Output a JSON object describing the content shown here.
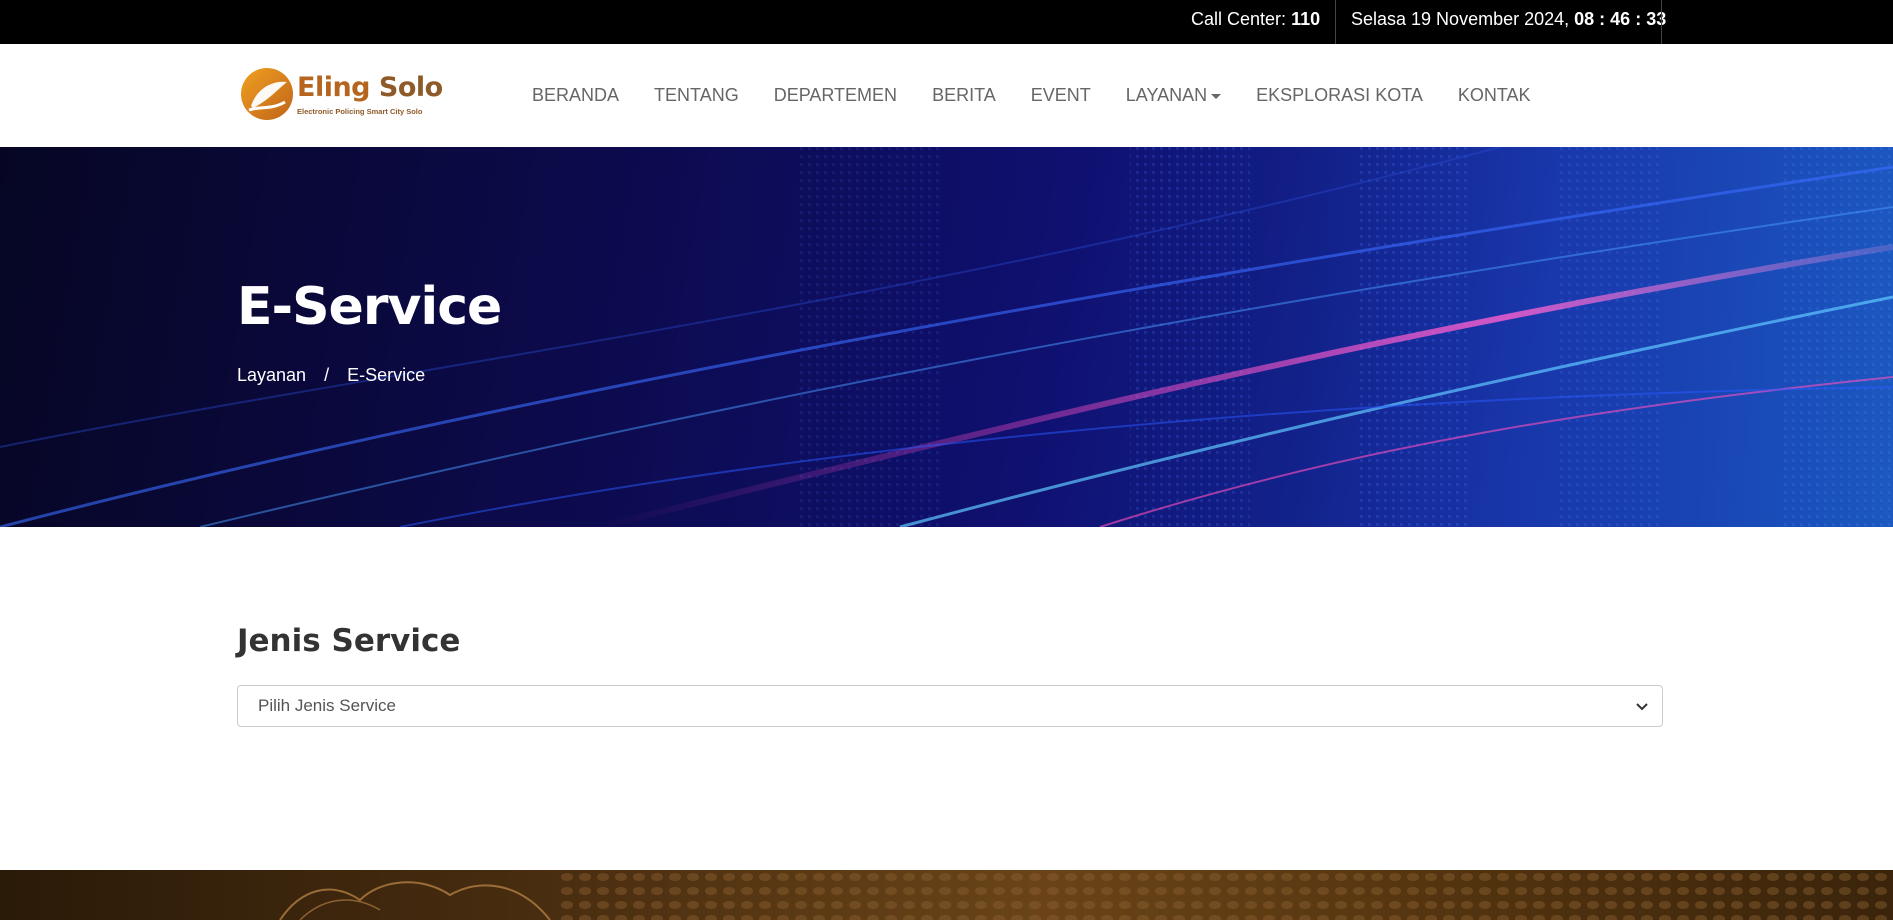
{
  "topbar": {
    "call_center_label": "Call Center:",
    "call_center_number": "110",
    "date": "Selasa 19 November 2024,",
    "time": "08 : 46 : 33"
  },
  "logo": {
    "name_part1": "Eling",
    "name_part2": "Solo",
    "tagline": "Electronic Policing Smart City Solo"
  },
  "nav": {
    "items": [
      "BERANDA",
      "TENTANG",
      "DEPARTEMEN",
      "BERITA",
      "EVENT",
      "LAYANAN",
      "EKSPLORASI KOTA",
      "KONTAK"
    ]
  },
  "hero": {
    "title": "E-Service",
    "breadcrumb": [
      "Layanan",
      "/",
      "E-Service"
    ]
  },
  "main": {
    "section_title": "Jenis Service",
    "select_value": "Pilih Jenis Service"
  },
  "colors": {
    "topbar_bg": "#000000",
    "nav_text": "#666666",
    "brand": "#b5651d",
    "hero_bg": "#0c0a4a"
  }
}
